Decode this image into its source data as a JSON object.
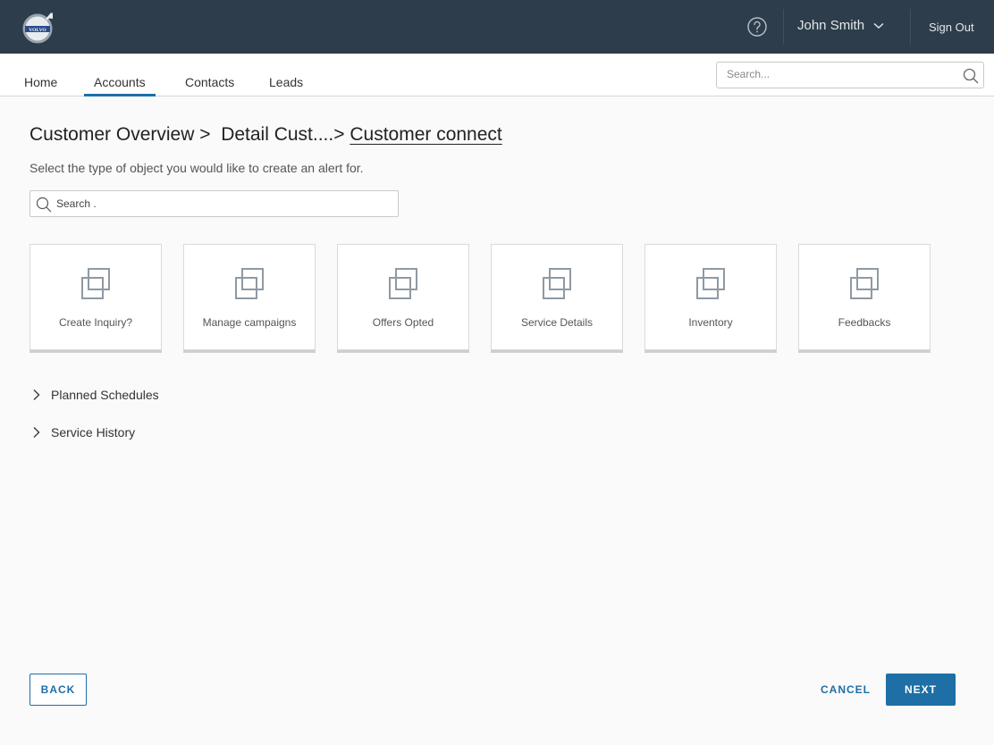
{
  "header": {
    "logo_icon": "volvo-logo",
    "help_icon": "help-circle-icon",
    "user_name": "John Smith",
    "sign_out": "Sign Out"
  },
  "nav": {
    "tabs": [
      {
        "label": "Home",
        "active": false
      },
      {
        "label": "Accounts",
        "active": true
      },
      {
        "label": "Contacts",
        "active": false
      },
      {
        "label": "Leads",
        "active": false
      }
    ],
    "search_placeholder": "Search..."
  },
  "breadcrumb": {
    "items": [
      "Customer Overview",
      "Detail Cust....",
      "Customer connect"
    ],
    "separator": ">"
  },
  "instruction": "Select the type of object you would like to create an alert for.",
  "search": {
    "placeholder": "Search ."
  },
  "cards": [
    {
      "label": "Create Inquiry?"
    },
    {
      "label": "Manage campaigns"
    },
    {
      "label": "Offers Opted"
    },
    {
      "label": "Service Details"
    },
    {
      "label": "Inventory"
    },
    {
      "label": "Feedbacks"
    }
  ],
  "sections": [
    {
      "label": "Planned Schedules"
    },
    {
      "label": "Service History"
    }
  ],
  "footer": {
    "back": "BACK",
    "cancel": "CANCEL",
    "next": "NEXT"
  },
  "colors": {
    "header_bg": "#2d3d4b",
    "accent": "#1d6fa5",
    "page_bg": "#fafafa"
  }
}
